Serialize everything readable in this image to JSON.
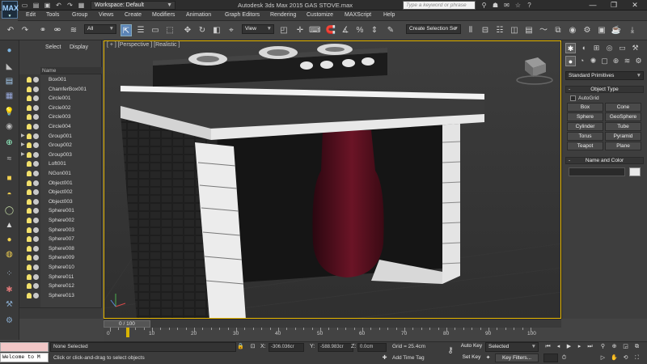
{
  "app": {
    "logo_text": "MAX",
    "workspace_label": "Workspace: Default",
    "window_title": "Autodesk 3ds Max  2015      GAS STOVE.max",
    "search_placeholder": "Type a keyword or phrase"
  },
  "menu": [
    "Edit",
    "Tools",
    "Group",
    "Views",
    "Create",
    "Modifiers",
    "Animation",
    "Graph Editors",
    "Rendering",
    "Customize",
    "MAXScript",
    "Help"
  ],
  "toolbar": {
    "filter_value": "All",
    "refcoord_value": "View",
    "selection_set_placeholder": "Create Selection Se"
  },
  "explorer": {
    "tab_select": "Select",
    "tab_display": "Display",
    "column_name": "Name",
    "items": [
      {
        "label": "Box001",
        "expand": ""
      },
      {
        "label": "ChamferBox001",
        "expand": ""
      },
      {
        "label": "Circle001",
        "expand": ""
      },
      {
        "label": "Circle002",
        "expand": ""
      },
      {
        "label": "Circle003",
        "expand": ""
      },
      {
        "label": "Circle004",
        "expand": ""
      },
      {
        "label": "Group001",
        "expand": "▶"
      },
      {
        "label": "Group002",
        "expand": "▶"
      },
      {
        "label": "Group003",
        "expand": "▶"
      },
      {
        "label": "Loft001",
        "expand": ""
      },
      {
        "label": "NGon001",
        "expand": ""
      },
      {
        "label": "Object001",
        "expand": ""
      },
      {
        "label": "Object002",
        "expand": ""
      },
      {
        "label": "Object003",
        "expand": ""
      },
      {
        "label": "Sphere001",
        "expand": ""
      },
      {
        "label": "Sphere002",
        "expand": ""
      },
      {
        "label": "Sphere003",
        "expand": ""
      },
      {
        "label": "Sphere007",
        "expand": ""
      },
      {
        "label": "Sphere008",
        "expand": ""
      },
      {
        "label": "Sphere009",
        "expand": ""
      },
      {
        "label": "Sphere010",
        "expand": ""
      },
      {
        "label": "Sphere011",
        "expand": ""
      },
      {
        "label": "Sphere012",
        "expand": ""
      },
      {
        "label": "Sphere013",
        "expand": ""
      }
    ]
  },
  "viewport": {
    "label": "[ + ] [Perspective ] [Realistic ]"
  },
  "command_panel": {
    "category_value": "Standard Primitives",
    "object_type_title": "Object Type",
    "autogrid_label": "AutoGrid",
    "primitives": [
      "Box",
      "Cone",
      "Sphere",
      "GeoSphere",
      "Cylinder",
      "Tube",
      "Torus",
      "Pyramid",
      "Teapot",
      "Plane"
    ],
    "name_color_title": "Name and Color",
    "swatch_color": "#e8e8e8"
  },
  "timeline": {
    "position_label": "0 / 100",
    "ticks": [
      "0",
      "10",
      "20",
      "30",
      "40",
      "50",
      "60",
      "70",
      "80",
      "90",
      "100"
    ]
  },
  "status": {
    "maxscript_text": "Welcome to M",
    "selection_text": "None Selected",
    "prompt_text": "Click or click-and-drag to select objects",
    "x_label": "X:",
    "x_value": "-306.036cr",
    "y_label": "Y:",
    "y_value": "-588.983cr",
    "z_label": "Z:",
    "z_value": "0.0cm",
    "grid_text": "Grid = 25.4cm",
    "add_time_tag": "Add Time Tag",
    "auto_key": "Auto Key",
    "set_key": "Set Key",
    "key_mode_value": "Selected",
    "key_filters": "Key Filters..."
  },
  "colors": {
    "accent": "#e8b800",
    "active_tool": "#5b84b6",
    "gas_cylinder": "#5a1020"
  }
}
